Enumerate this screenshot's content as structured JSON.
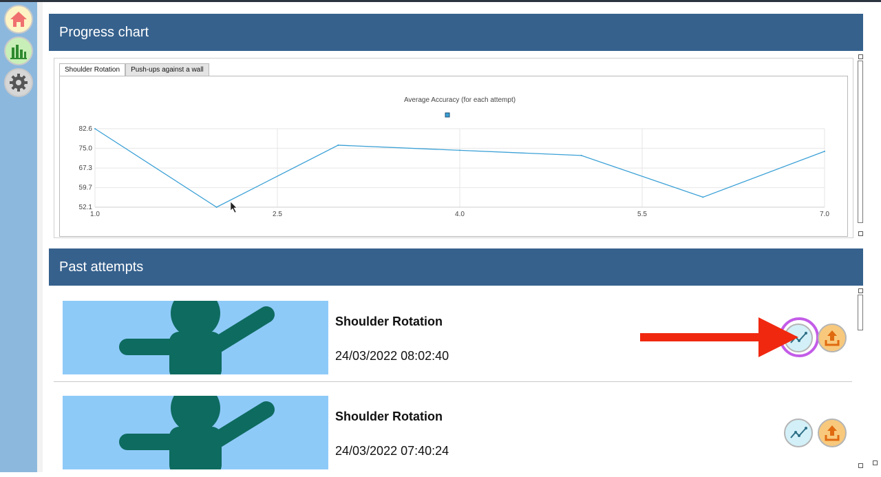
{
  "sidebar": {
    "items": [
      {
        "icon": "home-icon",
        "color": "#f07070"
      },
      {
        "icon": "bar-chart-icon",
        "color": "#2f8a2f"
      },
      {
        "icon": "gear-icon",
        "color": "#555555"
      }
    ]
  },
  "progress": {
    "header": "Progress chart",
    "tabs": [
      "Shoulder Rotation",
      "Push-ups against a wall"
    ],
    "active_tab": 0
  },
  "chart_data": {
    "type": "line",
    "title": "Average Accuracy (for each attempt)",
    "series": [
      {
        "values": [
          82.6,
          52.1,
          76.2,
          74.2,
          72.2,
          56.0,
          73.8
        ],
        "color": "#3aa0d6"
      }
    ],
    "x": [
      1.0,
      2.0,
      3.0,
      4.0,
      5.0,
      6.0,
      7.0
    ],
    "xlim": [
      1.0,
      7.0
    ],
    "ylim": [
      52.1,
      82.6
    ],
    "x_ticks": [
      "1.0",
      "2.5",
      "4.0",
      "5.5",
      "7.0"
    ],
    "y_ticks": [
      "82.6",
      "75.0",
      "67.3",
      "59.7",
      "52.1"
    ],
    "grid": true,
    "legend": "top-center"
  },
  "past": {
    "header": "Past attempts",
    "attempts": [
      {
        "title": "Shoulder Rotation",
        "date": "24/03/2022 08:02:40"
      },
      {
        "title": "Shoulder Rotation",
        "date": "24/03/2022 07:40:24"
      }
    ]
  },
  "colors": {
    "header_bg": "#36618d",
    "sidebar_bg": "#8db8dd",
    "thumb_bg": "#8ecaf8",
    "figure": "#0e6b60",
    "annotation_arrow": "#f02810",
    "annotation_ring": "#c35ce8"
  }
}
